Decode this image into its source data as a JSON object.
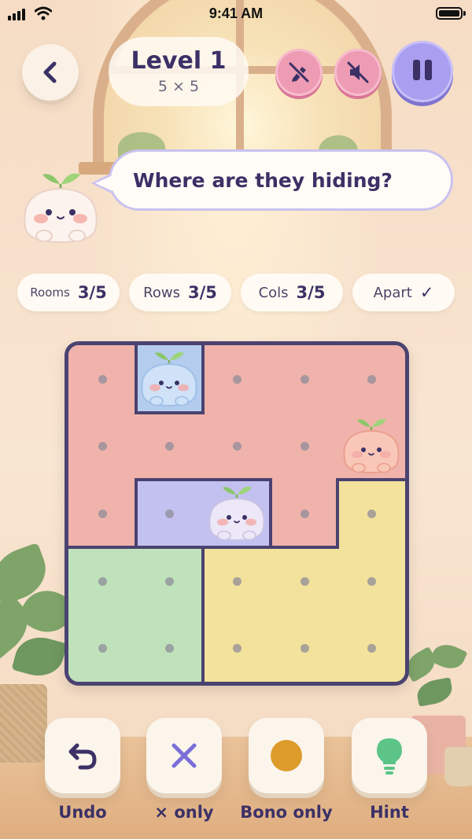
{
  "status_bar": {
    "time": "9:41 AM"
  },
  "header": {
    "back_icon": "chevron-left-icon",
    "level_title": "Level 1",
    "level_size": "5 × 5",
    "buttons": [
      {
        "name": "draw-off-button",
        "icon": "pencil-off-icon"
      },
      {
        "name": "sound-off-button",
        "icon": "speaker-muted-icon"
      },
      {
        "name": "pause-button",
        "icon": "pause-icon"
      }
    ]
  },
  "mascot": {
    "speech": "Where are they hiding?"
  },
  "constraints": [
    {
      "key": "Rooms",
      "value": "3/5"
    },
    {
      "key": "Rows",
      "value": "3/5"
    },
    {
      "key": "Cols",
      "value": "3/5"
    },
    {
      "key": "Apart",
      "value": "✓"
    }
  ],
  "board": {
    "size": 5,
    "colors": {
      "red": "#f0b3ab",
      "blue": "#b4cdee",
      "purple": "#c3c1ef",
      "yellow": "#f3e29b",
      "green": "#bfe2bb",
      "wall": "#4a4270"
    },
    "regions": [
      [
        "red",
        "blue",
        "red",
        "red",
        "red"
      ],
      [
        "red",
        "red",
        "red",
        "red",
        "red"
      ],
      [
        "red",
        "purple",
        "purple",
        "red",
        "yellow"
      ],
      [
        "green",
        "green",
        "yellow",
        "yellow",
        "yellow"
      ],
      [
        "green",
        "green",
        "yellow",
        "yellow",
        "yellow"
      ]
    ],
    "bonos": [
      {
        "row": 0,
        "col": 1,
        "color": "blue"
      },
      {
        "row": 1,
        "col": 4,
        "color": "peach"
      },
      {
        "row": 2,
        "col": 2,
        "color": "lavender"
      }
    ]
  },
  "tools": [
    {
      "label": "Undo",
      "icon": "undo-icon"
    },
    {
      "label": "× only",
      "icon": "x-mark-icon"
    },
    {
      "label": "Bono only",
      "icon": "circle-dot-icon"
    },
    {
      "label": "Hint",
      "icon": "lightbulb-icon"
    }
  ]
}
